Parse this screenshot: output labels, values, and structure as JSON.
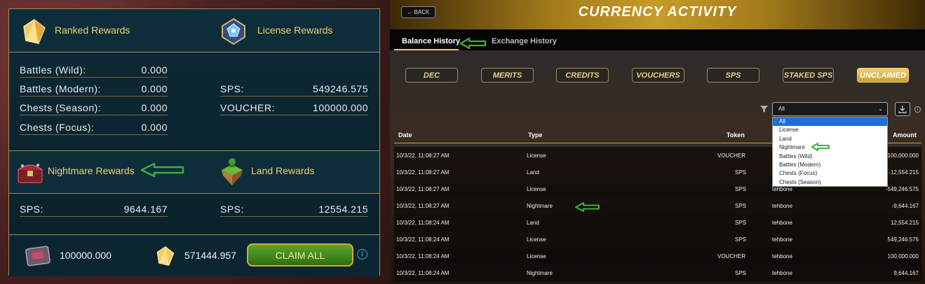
{
  "rewards": {
    "ranked": {
      "title": "Ranked Rewards",
      "rows": [
        {
          "label": "Battles (Wild):",
          "value": "0.000"
        },
        {
          "label": "Battles (Modern):",
          "value": "0.000"
        },
        {
          "label": "Chests (Season):",
          "value": "0.000"
        },
        {
          "label": "Chests (Focus):",
          "value": "0.000"
        }
      ]
    },
    "license": {
      "title": "License Rewards",
      "rows": [
        {
          "label": "SPS:",
          "value": "549246.575"
        },
        {
          "label": "VOUCHER:",
          "value": "100000.000"
        }
      ]
    },
    "nightmare": {
      "title": "Nightmare Rewards",
      "rows": [
        {
          "label": "SPS:",
          "value": "9644.167"
        }
      ]
    },
    "land": {
      "title": "Land Rewards",
      "rows": [
        {
          "label": "SPS:",
          "value": "12554.215"
        }
      ]
    },
    "footer": {
      "voucher_total": "100000.000",
      "sps_total": "571444.957",
      "claim_label": "CLAIM ALL",
      "info_glyph": "i"
    }
  },
  "activity": {
    "back_label": "BACK",
    "title": "CURRENCY ACTIVITY",
    "tabs": [
      {
        "label": "Balance History",
        "active": true
      },
      {
        "label": "Exchange History",
        "active": false
      }
    ],
    "currencies": [
      {
        "label": "DEC",
        "active": false
      },
      {
        "label": "MERITS",
        "active": false
      },
      {
        "label": "CREDITS",
        "active": false
      },
      {
        "label": "VOUCHERS",
        "active": false
      },
      {
        "label": "SPS",
        "active": false
      },
      {
        "label": "STAKED SPS",
        "active": false
      },
      {
        "label": "UNCLAIMED",
        "active": true
      }
    ],
    "filter": {
      "selected": "All",
      "options": [
        "All",
        "License",
        "Land",
        "Nightmare",
        "Battles (Wild)",
        "Battles (Modern)",
        "Chests (Focus)",
        "Chests (Season)"
      ]
    },
    "table": {
      "headers": {
        "date": "Date",
        "type": "Type",
        "token": "Token",
        "amount": "Amount"
      },
      "rows": [
        {
          "date": "10/3/22, 11:08:27 AM",
          "type": "License",
          "token": "VOUCHER",
          "user": "",
          "amount": "100,000.000"
        },
        {
          "date": "10/3/22, 11:08:27 AM",
          "type": "Land",
          "token": "SPS",
          "user": "",
          "amount": "-12,554.215"
        },
        {
          "date": "10/3/22, 11:08:27 AM",
          "type": "License",
          "token": "SPS",
          "user": "tehbone",
          "amount": "-549,246.575"
        },
        {
          "date": "10/3/22, 11:08:27 AM",
          "type": "Nightmare",
          "token": "SPS",
          "user": "tehbone",
          "amount": "-9,644.167"
        },
        {
          "date": "10/3/22, 11:08:24 AM",
          "type": "Land",
          "token": "SPS",
          "user": "tehbone",
          "amount": "12,554.215"
        },
        {
          "date": "10/3/22, 11:08:24 AM",
          "type": "License",
          "token": "SPS",
          "user": "tehbone",
          "amount": "549,246.575"
        },
        {
          "date": "10/3/22, 11:08:24 AM",
          "type": "License",
          "token": "VOUCHER",
          "user": "tehbone",
          "amount": "100,000.000"
        },
        {
          "date": "10/3/22, 11:08:24 AM",
          "type": "Nightmare",
          "token": "SPS",
          "user": "tehbone",
          "amount": "9,644.167"
        }
      ]
    }
  },
  "colors": {
    "accent_gold": "#f0d277",
    "annotation_green": "#3fae3f",
    "select_blue": "#1e6fd6"
  }
}
